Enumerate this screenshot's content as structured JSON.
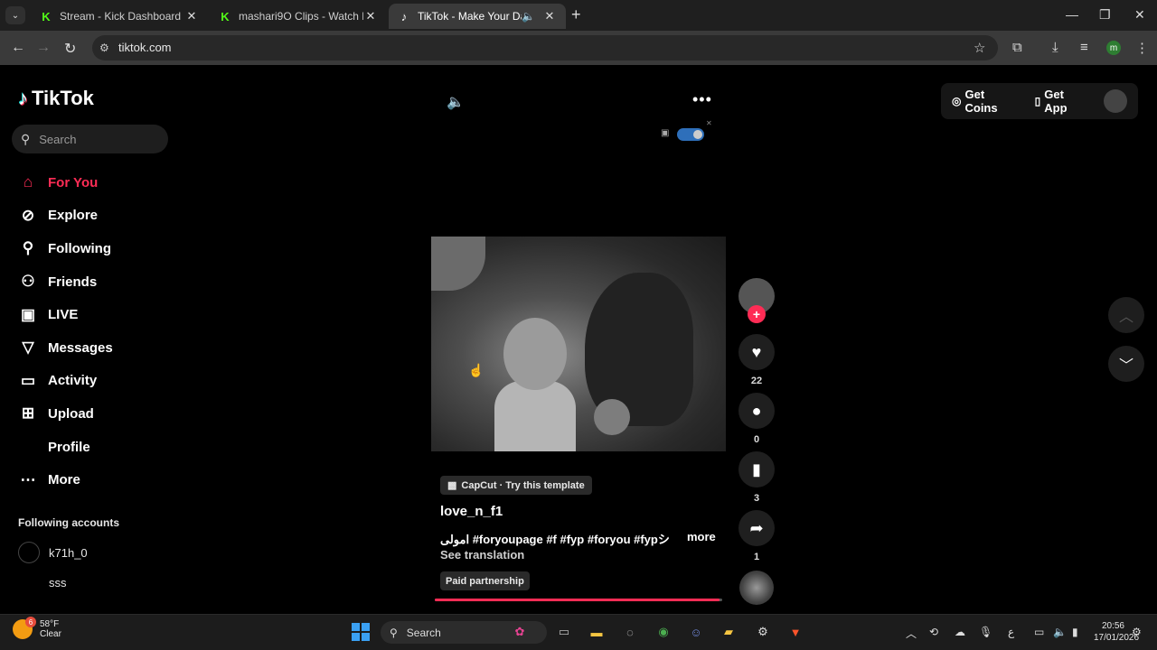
{
  "browser": {
    "tabs": [
      {
        "title": "Stream - Kick Dashboard",
        "favicon": "kick-icon"
      },
      {
        "title": "mashari9O Clips - Watch Live o",
        "favicon": "kick-icon"
      },
      {
        "title": "TikTok - Make Your Day",
        "favicon": "tiktok-icon",
        "active": true
      }
    ],
    "url": "tiktok.com",
    "profile_initial": "m"
  },
  "tiktok": {
    "logo_text": "TikTok",
    "search_placeholder": "Search",
    "nav": [
      {
        "label": "For You",
        "icon": "home-icon",
        "glyph": "⌂",
        "active": true
      },
      {
        "label": "Explore",
        "icon": "compass-icon",
        "glyph": "⊘"
      },
      {
        "label": "Following",
        "icon": "user-follow-icon",
        "glyph": "⚲"
      },
      {
        "label": "Friends",
        "icon": "friends-icon",
        "glyph": "⚇"
      },
      {
        "label": "LIVE",
        "icon": "live-tv-icon",
        "glyph": "▣"
      },
      {
        "label": "Messages",
        "icon": "send-icon",
        "glyph": "▽"
      },
      {
        "label": "Activity",
        "icon": "activity-icon",
        "glyph": "▭"
      },
      {
        "label": "Upload",
        "icon": "upload-plus-icon",
        "glyph": "⊞"
      },
      {
        "label": "Profile",
        "icon": "profile-icon",
        "glyph": ""
      },
      {
        "label": "More",
        "icon": "more-dots-icon",
        "glyph": "⋯"
      }
    ],
    "following_heading": "Following accounts",
    "following_accounts": [
      "k71h_0",
      "sss"
    ],
    "header": {
      "get_coins": "Get Coins",
      "get_app": "Get App"
    },
    "post": {
      "capcut_label": "CapCut · Try this template",
      "author": "love_n_f1",
      "description": "امولی #foryoupage #f #fyp #foryou #fypシ ...",
      "more_label": "more",
      "see_translation": "See translation",
      "paid_label": "Paid partnership",
      "progress": 0.99,
      "likes": "22",
      "comments": "0",
      "saves": "3",
      "shares": "1"
    }
  },
  "taskbar": {
    "temperature": "58°F",
    "condition": "Clear",
    "weather_badge": "6",
    "search_label": "Search",
    "time": "20:56",
    "date": "17/01/2026"
  }
}
